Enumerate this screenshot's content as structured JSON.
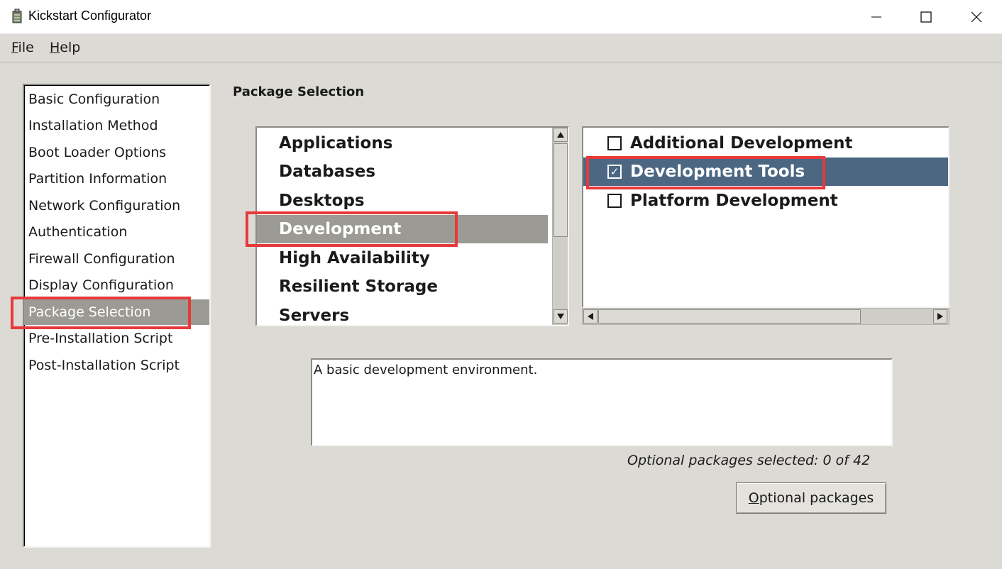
{
  "window": {
    "title": "Kickstart Configurator",
    "controls": [
      "minimize",
      "maximize",
      "close"
    ]
  },
  "menubar": {
    "file_pre": "",
    "file_mnemonic": "F",
    "file_rest": "ile",
    "help_mnemonic": "H",
    "help_rest": "elp"
  },
  "sidebar": {
    "items": [
      {
        "label": "Basic Configuration"
      },
      {
        "label": "Installation Method"
      },
      {
        "label": "Boot Loader Options"
      },
      {
        "label": "Partition Information"
      },
      {
        "label": "Network Configuration"
      },
      {
        "label": "Authentication"
      },
      {
        "label": "Firewall Configuration"
      },
      {
        "label": "Display Configuration"
      },
      {
        "label": "Package Selection"
      },
      {
        "label": "Pre-Installation Script"
      },
      {
        "label": "Post-Installation Script"
      }
    ],
    "selected": "Package Selection"
  },
  "main": {
    "title": "Package Selection",
    "groups": [
      {
        "label": "Applications"
      },
      {
        "label": "Databases"
      },
      {
        "label": "Desktops"
      },
      {
        "label": "Development"
      },
      {
        "label": "High Availability"
      },
      {
        "label": "Resilient Storage"
      },
      {
        "label": "Servers"
      }
    ],
    "selected_group": "Development",
    "packages": [
      {
        "label": "Additional Development",
        "checked": false,
        "check_glyph": ""
      },
      {
        "label": "Development Tools",
        "checked": true,
        "check_glyph": "✓"
      },
      {
        "label": "Platform Development",
        "checked": false,
        "check_glyph": ""
      }
    ],
    "selected_package": "Development Tools",
    "description": "A basic development environment.",
    "optional_count": "Optional packages selected: 0 of 42",
    "optional_button_mnemonic": "O",
    "optional_button_rest": "ptional packages"
  },
  "colors": {
    "sidebar_selected": "#9c9a94",
    "group_selected": "#9c9a94",
    "package_selected": "#4b6782",
    "highlight": "#e8393a"
  }
}
